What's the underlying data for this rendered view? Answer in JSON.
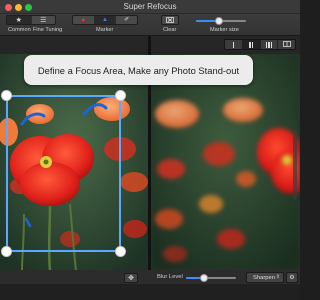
{
  "window": {
    "title": "Super Refocus"
  },
  "toolbar": {
    "mode_group": {
      "label_common": "Common",
      "label_fine_tuning": "Fine Tuning"
    },
    "marker_group": {
      "label": "Marker"
    },
    "clear": {
      "label": "Clear"
    },
    "marker_size": {
      "label": "Marker size",
      "value": 0.45
    }
  },
  "view_modes": {
    "selected": 1
  },
  "banner": {
    "text": "Define a Focus Area, Make any Photo Stand-out"
  },
  "bottom": {
    "blur_label": "Blur Level",
    "blur_value": 0.35,
    "sharpen_label": "Sharpen"
  },
  "icons": {
    "common": "star-icon",
    "fine_tuning": "list-icon",
    "marker_add": "red-marker-icon",
    "marker_remove": "blue-marker-icon",
    "marker_erase": "eraser-icon",
    "clear": "clear-icon",
    "move": "move-icon",
    "settings": "gear-icon"
  },
  "colors": {
    "accent": "#3b8ef5",
    "focus_frame": "#5aa8ff",
    "marker_red": "#e53935",
    "marker_blue": "#1e63d8"
  }
}
